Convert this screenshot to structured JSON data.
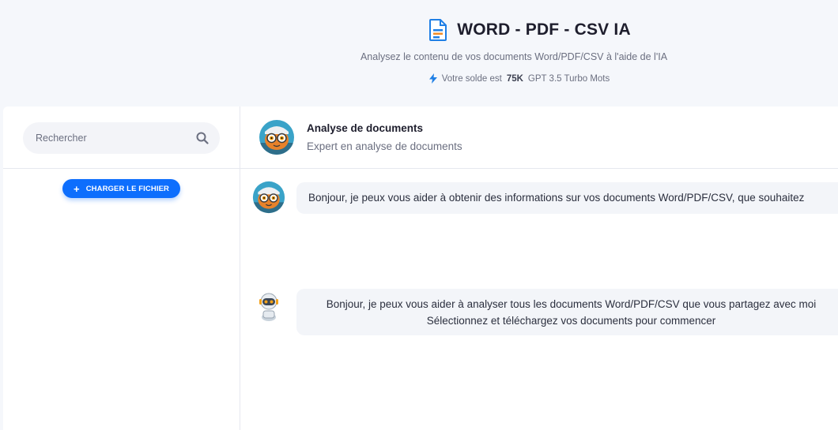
{
  "header": {
    "title": "WORD - PDF - CSV IA",
    "subtitle": "Analysez le contenu de vos documents Word/PDF/CSV à l'aide de l'IA",
    "balance_prefix": "Votre solde est",
    "balance_value": "75K",
    "balance_suffix": "GPT 3.5 Turbo Mots",
    "icon": "document-icon"
  },
  "sidebar": {
    "search_placeholder": "Rechercher",
    "upload_label": "CHARGER LE FICHIER"
  },
  "chat": {
    "assistant_name": "Analyse de documents",
    "assistant_role": "Expert en analyse de documents",
    "messages": [
      {
        "text": "Bonjour, je peux vous aider à obtenir des informations sur vos documents Word/PDF/CSV, que souhaitez"
      },
      {
        "line1": "Bonjour, je peux vous aider à analyser tous les documents Word/PDF/CSV que vous partagez avec moi",
        "line2": "Sélectionnez et téléchargez vos documents pour commencer"
      }
    ]
  },
  "colors": {
    "accent": "#0d6efd",
    "background": "#f5f7fb",
    "bubble": "#f3f5f9"
  }
}
